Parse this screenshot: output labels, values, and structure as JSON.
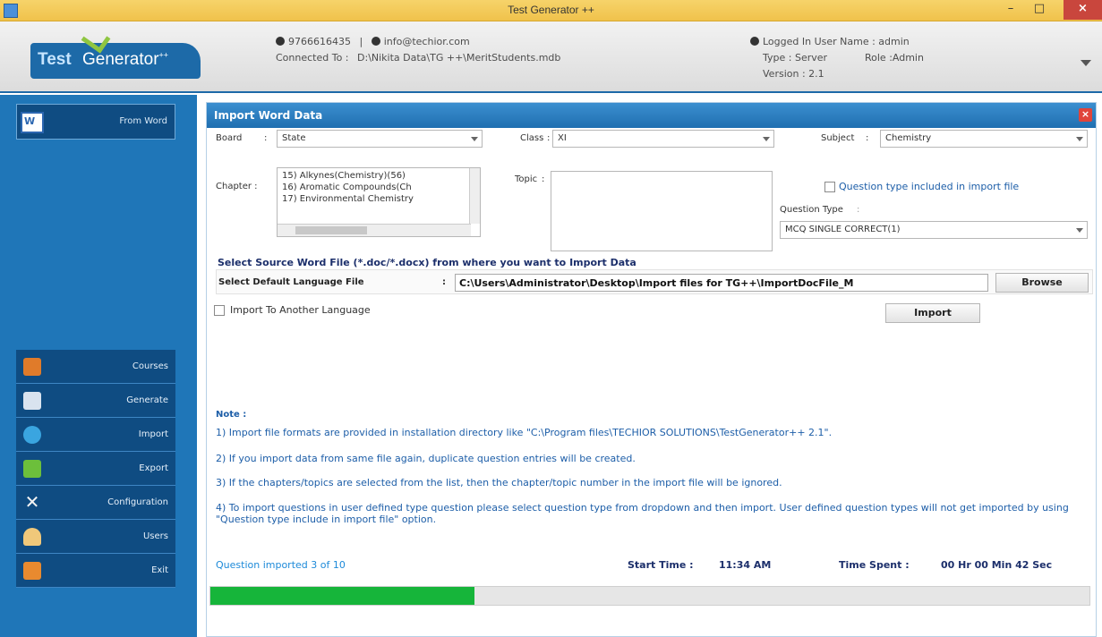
{
  "window": {
    "title": "Test Generator ++",
    "min": "–",
    "max": "□",
    "close": "×"
  },
  "header": {
    "logo_test": "Test",
    "logo_gen": "Generator",
    "logo_sup": "++",
    "phone": "9766616435",
    "separator": "|",
    "email": "info@techior.com",
    "connected_label": "Connected To :",
    "connected_path": "D:\\Nikita Data\\TG ++\\MeritStudents.mdb",
    "logged_in": "Logged In User Name : admin",
    "type": "Type : Server",
    "role": "Role :Admin",
    "version": "Version : 2.1"
  },
  "sidebar": {
    "active": {
      "label": "From Word",
      "icon": "word-icon"
    },
    "items": [
      {
        "label": "Courses",
        "icon": "courses-icon",
        "color": "#e07b2a"
      },
      {
        "label": "Generate",
        "icon": "generate-icon",
        "color": "#d9e3ef"
      },
      {
        "label": "Import",
        "icon": "import-icon",
        "color": "#3aa5e0"
      },
      {
        "label": "Export",
        "icon": "export-icon",
        "color": "#6cbf3b"
      },
      {
        "label": "Configuration",
        "icon": "configuration-icon",
        "color": "#f4f4f4"
      },
      {
        "label": "Users",
        "icon": "users-icon",
        "color": "#f0c87a"
      },
      {
        "label": "Exit",
        "icon": "exit-icon",
        "color": "#e98a2f"
      }
    ]
  },
  "panel": {
    "title": "Import Word Data",
    "board_label": "Board",
    "colon": ":",
    "board_value": "State",
    "class_label": "Class",
    "class_value": "XI",
    "subject_label": "Subject",
    "subject_value": "Chemistry",
    "chapter_label": "Chapter :",
    "chapters": [
      "15) Alkynes(Chemistry)(56)",
      "16) Aromatic Compounds(Ch",
      "17) Environmental Chemistry"
    ],
    "topic_label": "Topic",
    "qtype_included_label": "Question type included in import file",
    "question_type_label": "Question Type",
    "question_type_value": "MCQ SINGLE CORRECT(1)",
    "source_title": "Select Source Word File (*.doc/*.docx) from where you want to Import Data",
    "default_lang_label": "Select Default Language File",
    "file_path": "C:\\Users\\Administrator\\Desktop\\Import files for TG++\\ImportDocFile_M",
    "browse": "Browse",
    "import_another_lang": "Import To Another Language",
    "import_button": "Import",
    "note_title": "Note :",
    "notes": [
      "1) Import file formats are provided in installation directory like \"C:\\Program files\\TECHIOR SOLUTIONS\\TestGenerator++ 2.1\".",
      "2) If you import data from same file again, duplicate question entries will be created.",
      "3) If the chapters/topics are selected from the list, then the chapter/topic number in the import file will be ignored.",
      "4) To import questions in user defined type question please select question type from dropdown and then import. User defined question types will not get imported by using \"Question type include in import file\" option."
    ],
    "status_imported": "Question imported 3 of 10",
    "start_time_label": "Start Time :",
    "start_time": "11:34 AM",
    "time_spent_label": "Time Spent :",
    "time_spent": "00 Hr 00 Min 42 Sec",
    "progress_fraction": 0.3,
    "progress_color": "#16b53a"
  }
}
